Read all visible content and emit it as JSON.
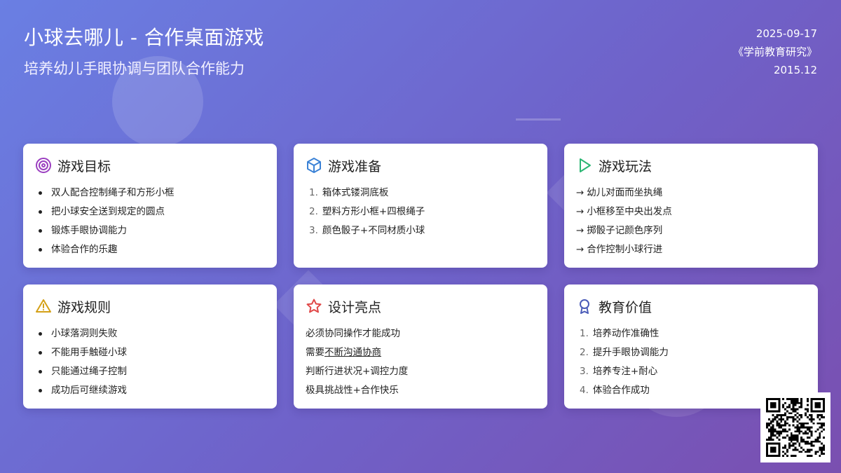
{
  "header": {
    "title": "小球去哪儿 - 合作桌面游戏",
    "subtitle": "培养幼儿手眼协调与团队合作能力"
  },
  "meta": {
    "date": "2025-09-17",
    "source": "《学前教育研究》",
    "issue": "2015.12"
  },
  "cards": {
    "goal": {
      "title": "游戏目标",
      "icon": "target-icon",
      "items": [
        "双人配合控制绳子和方形小框",
        "把小球安全送到规定的圆点",
        "锻炼手眼协调能力",
        "体验合作的乐趣"
      ]
    },
    "prep": {
      "title": "游戏准备",
      "icon": "cube-icon",
      "items": [
        {
          "num": "1.",
          "text": "箱体式镂洞底板"
        },
        {
          "num": "2.",
          "text": "塑料方形小框+四根绳子"
        },
        {
          "num": "3.",
          "text": "颜色骰子+不同材质小球"
        }
      ]
    },
    "play": {
      "title": "游戏玩法",
      "icon": "play-icon",
      "arrow": "→",
      "items": [
        "幼儿对面而坐执绳",
        "小框移至中央出发点",
        "掷骰子记颜色序列",
        "合作控制小球行进"
      ]
    },
    "rules": {
      "title": "游戏规则",
      "icon": "warning-icon",
      "items": [
        "小球落洞则失败",
        "不能用手触碰小球",
        "只能通过绳子控制",
        "成功后可继续游戏"
      ]
    },
    "highlights": {
      "title": "设计亮点",
      "icon": "star-icon",
      "item1": "必须协同操作才能成功",
      "item2_prefix": "需要",
      "item2_underlined": "不断沟通协商",
      "item3": "判断行进状况+调控力度",
      "item4": "极具挑战性+合作快乐"
    },
    "value": {
      "title": "教育价值",
      "icon": "award-icon",
      "items": [
        {
          "num": "1.",
          "text": "培养动作准确性"
        },
        {
          "num": "2.",
          "text": "提升手眼协调能力"
        },
        {
          "num": "3.",
          "text": "培养专注+耐心"
        },
        {
          "num": "4.",
          "text": "体验合作成功"
        }
      ]
    }
  },
  "colors": {
    "target": "#9b3fc0",
    "cube": "#3b82d6",
    "play": "#2bb673",
    "warning": "#d4a017",
    "star": "#e04848",
    "award": "#4a5bb8"
  },
  "qr": {
    "icon": "qr-code-icon"
  }
}
